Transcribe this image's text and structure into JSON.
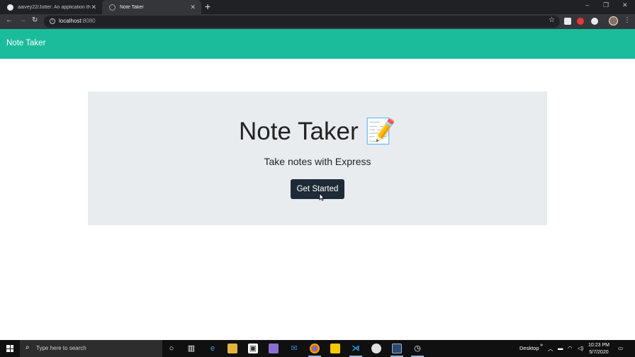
{
  "browser": {
    "tabs": [
      {
        "title": "aaivey22/Jotter: An application th",
        "active": false
      },
      {
        "title": "Note Taker",
        "active": true
      }
    ],
    "url_host": "localhost",
    "url_port": ":8080"
  },
  "navbar": {
    "brand": "Note Taker",
    "color": "#1abc9c"
  },
  "jumbotron": {
    "title": "Note Taker 📝",
    "lead": "Take notes with Express",
    "button_label": "Get Started"
  },
  "taskbar": {
    "search_placeholder": "Type here to search",
    "tray_label": "Desktop",
    "time": "10:23 PM",
    "date": "5/7/2020"
  }
}
